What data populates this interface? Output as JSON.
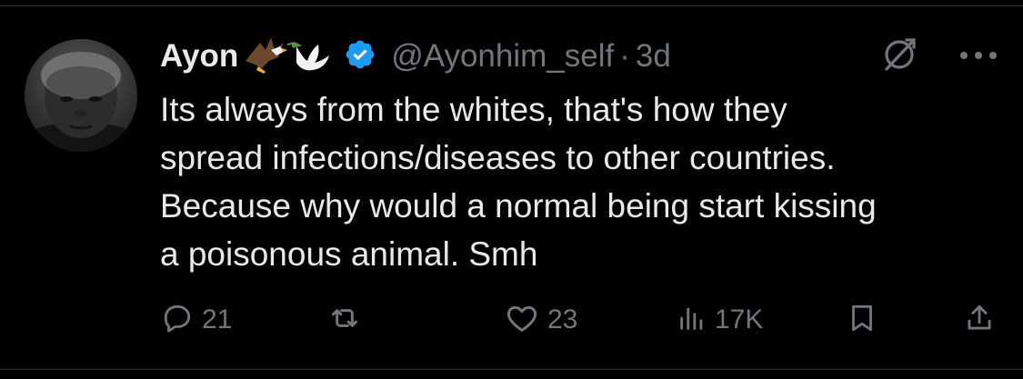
{
  "tweet": {
    "author_name": "Ayon",
    "author_emoji": "🦅🕊",
    "handle": "@Ayonhim_self",
    "separator": "·",
    "time": "3d",
    "text_lines": [
      "Its always from the whites, that's how they",
      "spread infections/diseases to other countries.",
      "Because why would a normal being start kissing",
      "a poisonous animal. Smh"
    ]
  },
  "actions": {
    "replies": "21",
    "reposts": "",
    "likes": "23",
    "views": "17K"
  },
  "icons": {
    "verified": "verified-badge-icon",
    "grok": "grok-icon",
    "more": "more-icon",
    "reply": "reply-icon",
    "repost": "repost-icon",
    "like": "like-icon",
    "views": "views-icon",
    "bookmark": "bookmark-icon",
    "share": "share-icon"
  },
  "colors": {
    "background": "#000000",
    "text": "#e7e9ea",
    "secondary": "#71767b",
    "verified": "#1d9bf0",
    "divider": "#2f3336"
  }
}
